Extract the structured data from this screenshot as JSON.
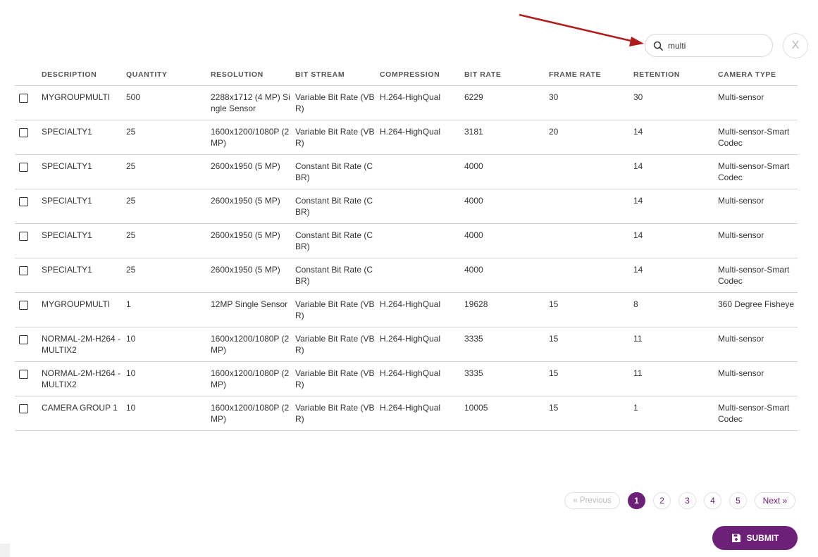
{
  "search": {
    "value": "multi",
    "placeholder": ""
  },
  "clear_label": "X",
  "columns": [
    "DESCRIPTION",
    "QUANTITY",
    "RESOLUTION",
    "BIT STREAM",
    "COMPRESSION",
    "BIT RATE",
    "FRAME RATE",
    "RETENTION",
    "CAMERA TYPE"
  ],
  "rows": [
    {
      "description": "MYGROUPMULTI",
      "quantity": "500",
      "resolution": "2288x1712 (4 MP) Single Sensor",
      "bit_stream": "Variable Bit Rate (VBR)",
      "compression": "H.264-HighQual",
      "bit_rate": "6229",
      "frame_rate": "30",
      "retention": "30",
      "camera_type": "Multi-sensor"
    },
    {
      "description": "SPECIALTY1",
      "quantity": "25",
      "resolution": "1600x1200/1080P (2 MP)",
      "bit_stream": "Variable Bit Rate (VBR)",
      "compression": "H.264-HighQual",
      "bit_rate": "3181",
      "frame_rate": "20",
      "retention": "14",
      "camera_type": "Multi-sensor-Smart Codec"
    },
    {
      "description": "SPECIALTY1",
      "quantity": "25",
      "resolution": "2600x1950 (5 MP)",
      "bit_stream": "Constant Bit Rate (CBR)",
      "compression": "",
      "bit_rate": "4000",
      "frame_rate": "",
      "retention": "14",
      "camera_type": "Multi-sensor-Smart Codec"
    },
    {
      "description": "SPECIALTY1",
      "quantity": "25",
      "resolution": "2600x1950 (5 MP)",
      "bit_stream": "Constant Bit Rate (CBR)",
      "compression": "",
      "bit_rate": "4000",
      "frame_rate": "",
      "retention": "14",
      "camera_type": "Multi-sensor"
    },
    {
      "description": "SPECIALTY1",
      "quantity": "25",
      "resolution": "2600x1950 (5 MP)",
      "bit_stream": "Constant Bit Rate (CBR)",
      "compression": "",
      "bit_rate": "4000",
      "frame_rate": "",
      "retention": "14",
      "camera_type": "Multi-sensor"
    },
    {
      "description": "SPECIALTY1",
      "quantity": "25",
      "resolution": "2600x1950 (5 MP)",
      "bit_stream": "Constant Bit Rate (CBR)",
      "compression": "",
      "bit_rate": "4000",
      "frame_rate": "",
      "retention": "14",
      "camera_type": "Multi-sensor-Smart Codec"
    },
    {
      "description": "MYGROUPMULTI",
      "quantity": "1",
      "resolution": "12MP Single Sensor",
      "bit_stream": "Variable Bit Rate (VBR)",
      "compression": "H.264-HighQual",
      "bit_rate": "19628",
      "frame_rate": "15",
      "retention": "8",
      "camera_type": "360 Degree Fisheye"
    },
    {
      "description": "NORMAL-2M-H264 - MULTIX2",
      "quantity": "10",
      "resolution": "1600x1200/1080P (2 MP)",
      "bit_stream": "Variable Bit Rate (VBR)",
      "compression": "H.264-HighQual",
      "bit_rate": "3335",
      "frame_rate": "15",
      "retention": "11",
      "camera_type": "Multi-sensor"
    },
    {
      "description": "NORMAL-2M-H264 - MULTIX2",
      "quantity": "10",
      "resolution": "1600x1200/1080P (2 MP)",
      "bit_stream": "Variable Bit Rate (VBR)",
      "compression": "H.264-HighQual",
      "bit_rate": "3335",
      "frame_rate": "15",
      "retention": "11",
      "camera_type": "Multi-sensor"
    },
    {
      "description": "CAMERA GROUP 1",
      "quantity": "10",
      "resolution": "1600x1200/1080P (2 MP)",
      "bit_stream": "Variable Bit Rate (VBR)",
      "compression": "H.264-HighQual",
      "bit_rate": "10005",
      "frame_rate": "15",
      "retention": "1",
      "camera_type": "Multi-sensor-Smart Codec"
    }
  ],
  "pagination": {
    "previous": "« Previous",
    "pages": [
      "1",
      "2",
      "3",
      "4",
      "5"
    ],
    "current": "1",
    "next": "Next »"
  },
  "submit_label": "SUBMIT",
  "colors": {
    "accent": "#6d2077",
    "arrow": "#b01c1c"
  },
  "icons": {
    "search": "search-icon",
    "clear": "close-icon",
    "submit": "save-icon",
    "annotation": "arrow-annotation"
  }
}
